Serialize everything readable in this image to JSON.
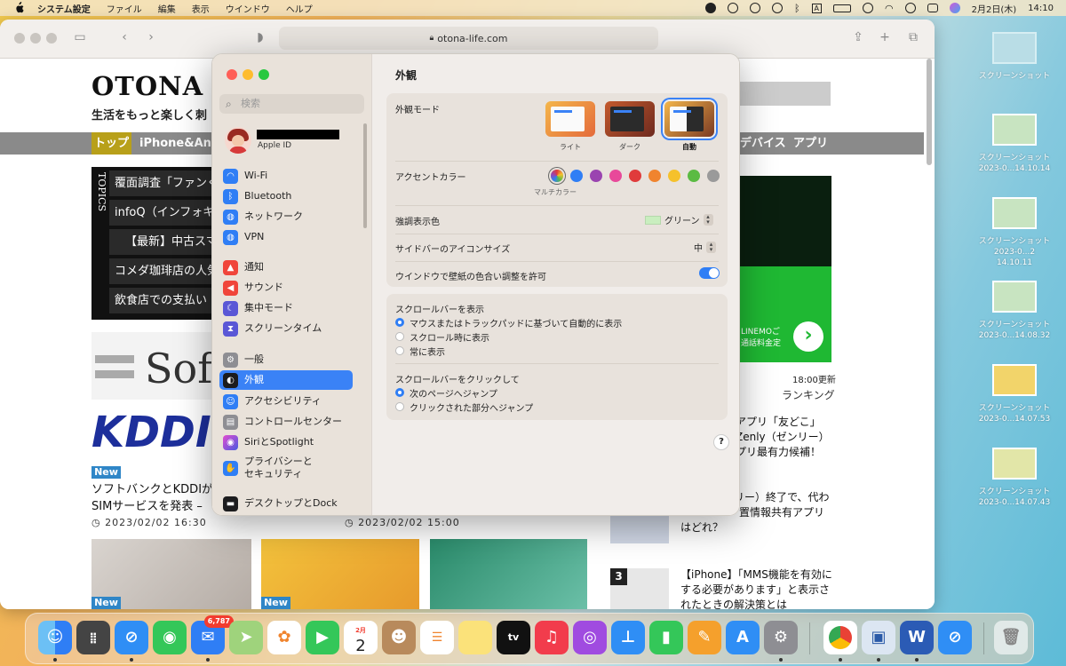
{
  "menubar": {
    "app": "システム設定",
    "items": [
      "ファイル",
      "編集",
      "表示",
      "ウインドウ",
      "ヘルプ"
    ],
    "date": "2月2日(木)",
    "time": "14:10"
  },
  "browser": {
    "url": "otona-life.com"
  },
  "webpage": {
    "logo": "OTONA L",
    "tagline": "生活をもっと楽しく刺",
    "nav": [
      "トップ",
      "iPhone&And",
      "デバイス",
      "アプリ"
    ],
    "topics_label": "TOPICS",
    "topics": [
      "覆面調査「ファンく",
      "infoQ（インフォキ",
      "【最新】中古スマホ",
      "コメダ珈琲店の人気",
      "飲食店での支払い"
    ],
    "sof_text": "Sof",
    "kddi_text": "KDDI",
    "new_badge": "New",
    "article_title_1": "ソフトバンクとKDDIが",
    "article_title_2": "SIMサービスを発表 –",
    "date1": "2023/02/02 16:30",
    "date2": "2023/02/02 15:00",
    "update_time": "18:00更新",
    "ranking": "ランキング",
    "rank_text_1": "アプリ「友どこ」",
    "rank_text_2": "Zenly（ゼンリー）",
    "rank_text_3": "プリ最有力候補！",
    "rank_text_4": "リー）終了で、代わ",
    "rank_text_5": "置情報共有アプリ",
    "rank_text_6": "はどれ？",
    "rank_num": "3",
    "rank3_line1": "【iPhone】「MMS機能を有効に",
    "rank3_line2": "する必要があります」と表示さ",
    "rank3_line3": "れたときの解決策とは",
    "ad_text_1": "LINEMOご",
    "ad_text_2": "通話料金定"
  },
  "settings": {
    "search_placeholder": "検索",
    "account_sub": "Apple ID",
    "sidebar": [
      {
        "label": "Wi-Fi",
        "icon": "wifi-icon",
        "color": "#2f7ef5"
      },
      {
        "label": "Bluetooth",
        "icon": "bluetooth-icon",
        "color": "#2f7ef5"
      },
      {
        "label": "ネットワーク",
        "icon": "globe-icon",
        "color": "#2f7ef5"
      },
      {
        "label": "VPN",
        "icon": "vpn-icon",
        "color": "#2f7ef5"
      },
      {
        "label": "通知",
        "icon": "bell-icon",
        "color": "#f0453a"
      },
      {
        "label": "サウンド",
        "icon": "speaker-icon",
        "color": "#f0453a"
      },
      {
        "label": "集中モード",
        "icon": "moon-icon",
        "color": "#5a57d6"
      },
      {
        "label": "スクリーンタイム",
        "icon": "hourglass-icon",
        "color": "#5a57d6"
      },
      {
        "label": "一般",
        "icon": "gear-icon",
        "color": "#8e8e93"
      },
      {
        "label": "外観",
        "icon": "appearance-icon",
        "color": "#1c1c1e"
      },
      {
        "label": "アクセシビリティ",
        "icon": "accessibility-icon",
        "color": "#2f7ef5"
      },
      {
        "label": "コントロールセンター",
        "icon": "control-center-icon",
        "color": "#8e8e93"
      },
      {
        "label": "SiriとSpotlight",
        "icon": "siri-icon",
        "color": "#5b3fd6"
      },
      {
        "label": "プライバシーと\nセキュリティ",
        "icon": "hand-icon",
        "color": "#2f7ef5"
      },
      {
        "label": "デスクトップとDock",
        "icon": "dock-icon",
        "color": "#1c1c1e"
      }
    ],
    "selected": "外観",
    "title": "外観",
    "appearance_mode_label": "外観モード",
    "modes": [
      "ライト",
      "ダーク",
      "自動"
    ],
    "mode_selected": "自動",
    "accent_label": "アクセントカラー",
    "accent_colors": [
      "#8f5bd6",
      "#2f7ef5",
      "#9a44b0",
      "#e8499a",
      "#e03b3b",
      "#f0842e",
      "#f5c12c",
      "#5bbb43",
      "#9a9a9a"
    ],
    "accent_caption": "マルチカラー",
    "highlight_label": "強調表示色",
    "highlight_value": "グリーン",
    "sidebar_icon_label": "サイドバーのアイコンサイズ",
    "sidebar_icon_value": "中",
    "tint_label": "ウインドウで壁紙の色合い調整を許可",
    "tint_on": true,
    "scroll_show_label": "スクロールバーを表示",
    "scroll_show_options": [
      "マウスまたはトラックパッドに基づいて自動的に表示",
      "スクロール時に表示",
      "常に表示"
    ],
    "scroll_click_label": "スクロールバーをクリックして",
    "scroll_click_options": [
      "次のページへジャンプ",
      "クリックされた部分へジャンプ"
    ],
    "help": "?"
  },
  "desktop": [
    {
      "caption": "スクリーンショット"
    },
    {
      "caption": "スクリーンショット\n2023-0...14.10.14"
    },
    {
      "caption": "スクリーンショット\n2023-0...2 14.10.11"
    },
    {
      "caption": "スクリーンショット\n2023-0...14.08.32"
    },
    {
      "caption": "スクリーンショット\n2023-0...14.07.53"
    },
    {
      "caption": "スクリーンショット\n2023-0...14.07.43"
    }
  ],
  "dock": {
    "mail_badge": "6,787",
    "calendar_month": "2月",
    "calendar_day": "2",
    "tv_label": "tv",
    "keynote_label": "W"
  }
}
